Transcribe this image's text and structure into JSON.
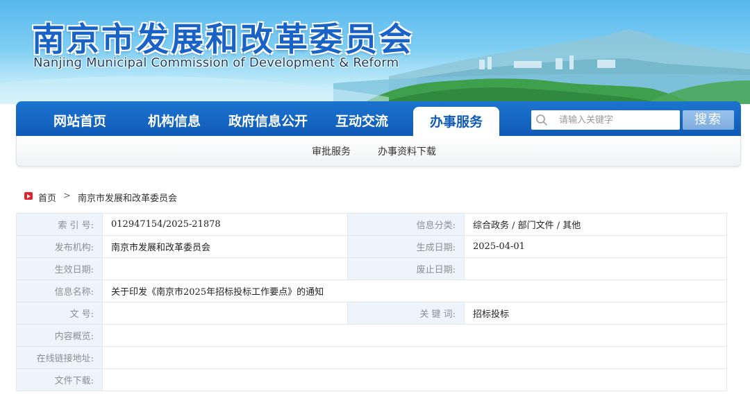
{
  "header": {
    "title": "南京市发展和改革委员会",
    "subtitle": "Nanjing Municipal Commission of Development & Reform"
  },
  "nav": {
    "items": [
      {
        "label": "网站首页"
      },
      {
        "label": "机构信息"
      },
      {
        "label": "政府信息公开"
      },
      {
        "label": "互动交流"
      },
      {
        "label": "办事服务",
        "active": true
      }
    ],
    "search": {
      "placeholder": "请输入关键字",
      "value": "",
      "button_label": "搜索",
      "icon": "search-icon"
    }
  },
  "subnav": {
    "items": [
      {
        "label": "审批服务"
      },
      {
        "label": "办事资料下载"
      }
    ]
  },
  "breadcrumb": {
    "icon": "play-icon",
    "home": "首页",
    "separator": ">",
    "current": "南京市发展和改革委员会"
  },
  "info": {
    "index_label": "索  引  号:",
    "index_value": "012947154/2025-21878",
    "category_label": "信息分类:",
    "category_value": "综合政务 / 部门文件 / 其他",
    "publisher_label": "发布机构:",
    "publisher_value": "南京市发展和改革委员会",
    "created_label": "生成日期:",
    "created_value": "2025-04-01",
    "effective_label": "生效日期:",
    "effective_value": "",
    "expiry_label": "废止日期:",
    "expiry_value": "",
    "name_label": "信息名称:",
    "name_value": "关于印发《南京市2025年招标投标工作要点》的通知",
    "doc_no_label": "文    号:",
    "doc_no_value": "",
    "keywords_label": "关  键  词:",
    "keywords_value": "招标投标",
    "summary_label": "内容概览:",
    "summary_value": "",
    "link_label": "在线链接地址:",
    "link_value": "",
    "download_label": "文件下载:",
    "download_value": ""
  },
  "colors": {
    "nav_blue": "#0f5bb7",
    "title_blue": "#1a63c6",
    "label_bg": "#eef4fb",
    "breadcrumb_red": "#e0262d"
  }
}
